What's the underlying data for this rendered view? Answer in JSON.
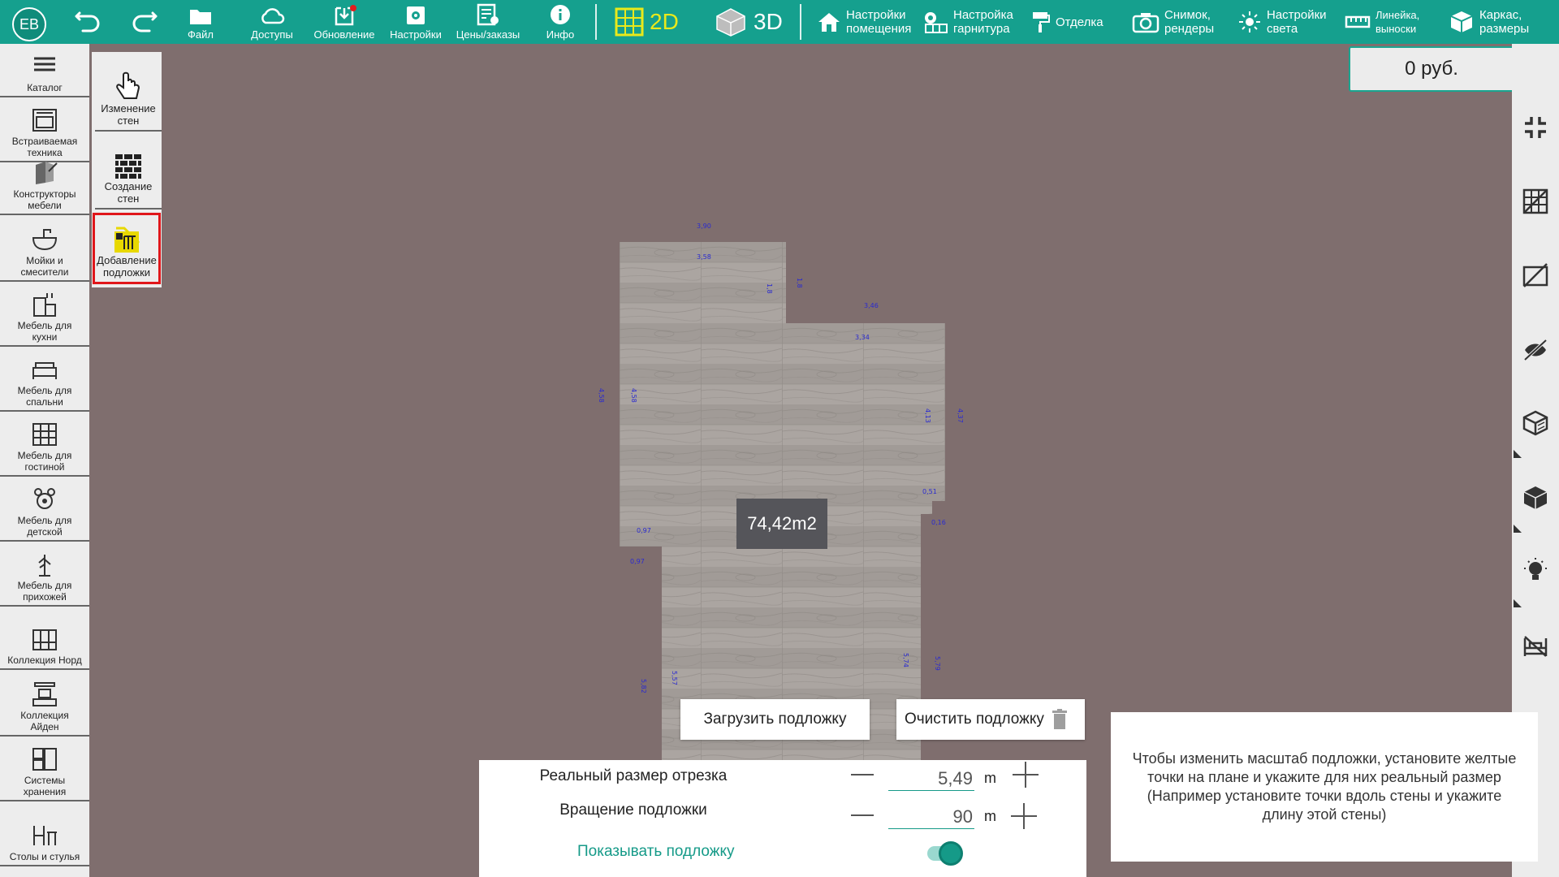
{
  "toolbar": {
    "avatar": "ЕВ",
    "file": "Файл",
    "access": "Доступы",
    "update": "Обновление",
    "settings": "Настройки",
    "prices": "Цены/заказы",
    "info": "Инфо",
    "mode_2d": "2D",
    "mode_3d": "3D",
    "room_settings_1": "Настройки",
    "room_settings_2": "помещения",
    "set_settings_1": "Настройка",
    "set_settings_2": "гарнитура",
    "finish": "Отделка",
    "snapshot_1": "Снимок,",
    "snapshot_2": "рендеры",
    "light_1": "Настройки",
    "light_2": "света",
    "ruler_1": "Линейка,",
    "ruler_2": "выноски",
    "frame_1": "Каркас,",
    "frame_2": "размеры",
    "accent": "#15a08e"
  },
  "sidebar": {
    "items": [
      {
        "l1": "Каталог",
        "l2": ""
      },
      {
        "l1": "Встраиваемая",
        "l2": "техника"
      },
      {
        "l1": "Конструкторы",
        "l2": "мебели"
      },
      {
        "l1": "Мойки и",
        "l2": "смесители"
      },
      {
        "l1": "Мебель для",
        "l2": "кухни"
      },
      {
        "l1": "Мебель для",
        "l2": "спальни"
      },
      {
        "l1": "Мебель для",
        "l2": "гостиной"
      },
      {
        "l1": "Мебель для",
        "l2": "детской"
      },
      {
        "l1": "Мебель для",
        "l2": "прихожей"
      },
      {
        "l1": "Коллекция Норд",
        "l2": ""
      },
      {
        "l1": "Коллекция",
        "l2": "Айден"
      },
      {
        "l1": "Системы",
        "l2": "хранения"
      },
      {
        "l1": "Столы и стулья",
        "l2": ""
      }
    ]
  },
  "wallpanel": {
    "edit_1": "Изменение",
    "edit_2": "стен",
    "create_1": "Создание",
    "create_2": "стен",
    "underlay_1": "Добавление",
    "underlay_2": "подложки"
  },
  "plan": {
    "area": "74,42m2"
  },
  "cart": {
    "price": "0 руб."
  },
  "actions": {
    "load_underlay": "Загрузить подложку",
    "clear_underlay": "Очистить подложку"
  },
  "scale_panel": {
    "segment_label": "Реальный размер отрезка",
    "segment_value": "5,49",
    "segment_unit": "m",
    "rotation_label": "Вращение подложки",
    "rotation_value": "90",
    "rotation_unit": "m",
    "show_label": "Показывать подложку",
    "show_enabled": true
  },
  "hint": {
    "text": "Чтобы изменить масштаб подложки, установите желтые точки на плане и укажите для них реальный размер (Например установите точки вдоль стены и укажите длину этой стены)"
  }
}
